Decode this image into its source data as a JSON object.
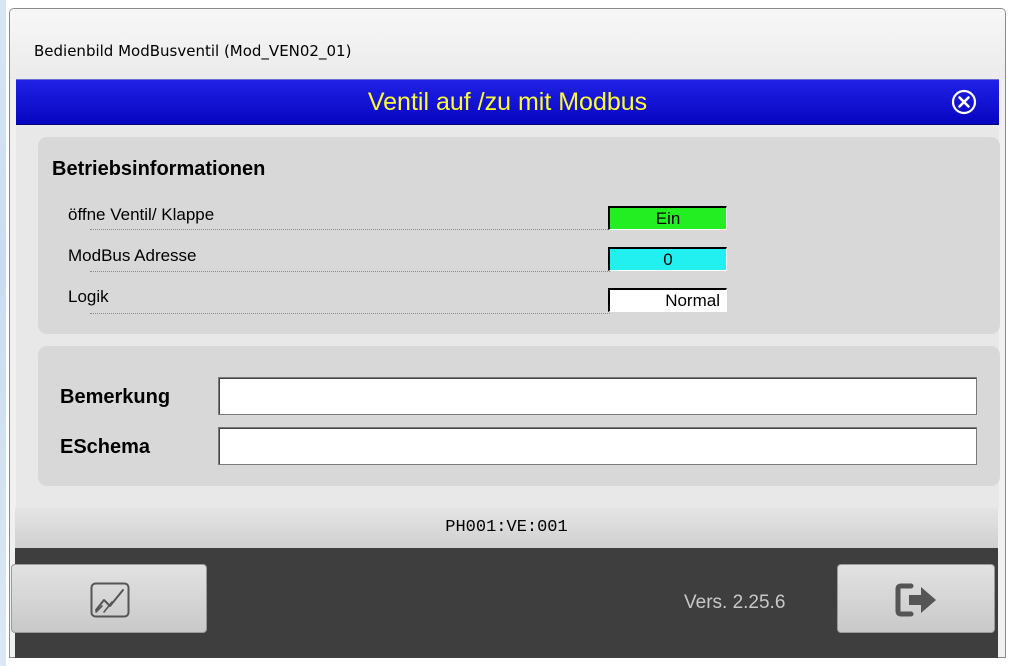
{
  "window": {
    "title": "Bedienbild ModBusventil (Mod_VEN02_01)"
  },
  "header": {
    "title": "Ventil auf /zu mit Modbus",
    "close_icon": "close-circle-icon"
  },
  "info_panel": {
    "title": "Betriebsinformationen",
    "rows": [
      {
        "label": "öffne Ventil/ Klappe",
        "value": "Ein",
        "color": "#22ee22"
      },
      {
        "label": "ModBus Adresse",
        "value": "0",
        "color": "#22f0f0"
      },
      {
        "label": "Logik",
        "value": "Normal",
        "color": "#ffffff"
      }
    ]
  },
  "remark_panel": {
    "bemerkung_label": "Bemerkung",
    "bemerkung_value": "",
    "eschema_label": "ESchema",
    "eschema_value": ""
  },
  "status": {
    "tag": "PH001:VE:001"
  },
  "footer": {
    "trend_button_icon": "trend-chart-icon",
    "version": "Vers. 2.25.6",
    "exit_button_icon": "exit-arrow-icon"
  },
  "colors": {
    "header_bg": "#0a0ad0",
    "header_text": "#ffff33",
    "footer_bg": "#3e3e3e"
  }
}
